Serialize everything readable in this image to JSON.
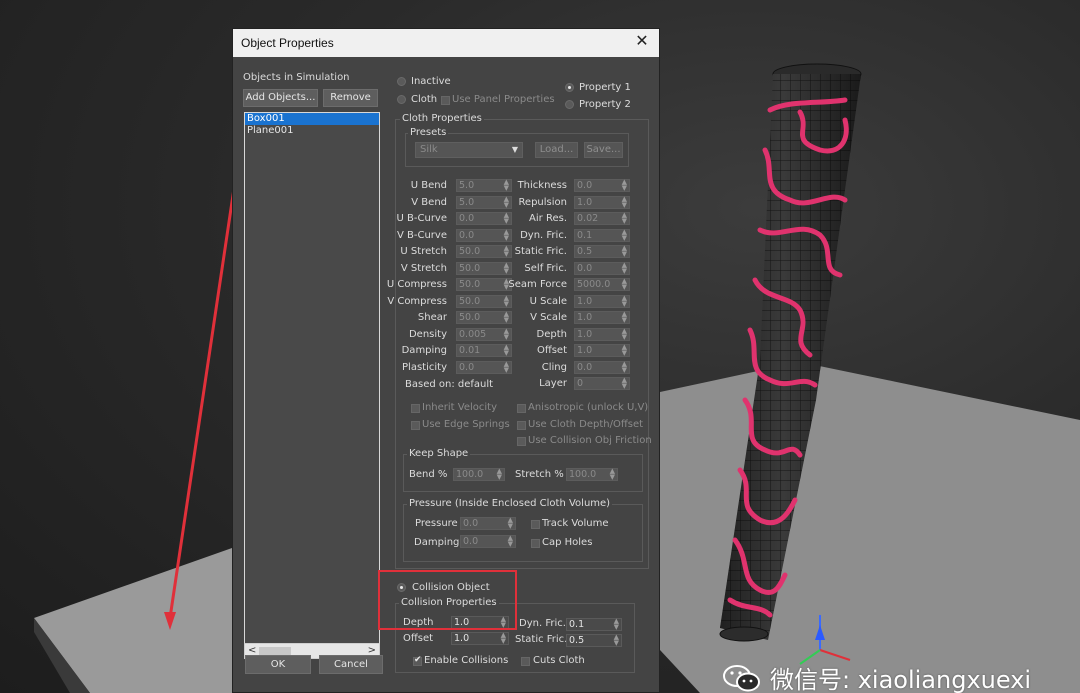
{
  "dialog": {
    "title": "Object Properties",
    "close_glyph": "✕",
    "objects_heading": "Objects in Simulation",
    "add_button": "Add Objects...",
    "remove_button": "Remove",
    "objects": [
      "Box001",
      "Plane001"
    ],
    "selected_object": "Box001",
    "ok_button": "OK",
    "cancel_button": "Cancel",
    "scroll_left": "<",
    "scroll_right": ">"
  },
  "mode": {
    "inactive_label": "Inactive",
    "cloth_label": "Cloth",
    "use_panel_label": "Use Panel Properties",
    "property1_label": "Property 1",
    "property2_label": "Property 2",
    "selected_property": "Property 1"
  },
  "cloth": {
    "heading": "Cloth Properties",
    "presets_heading": "Presets",
    "preset_value": "Silk",
    "load_button": "Load...",
    "save_button": "Save...",
    "left_params": [
      {
        "label": "U Bend",
        "value": "5.0"
      },
      {
        "label": "V Bend",
        "value": "5.0"
      },
      {
        "label": "U B-Curve",
        "value": "0.0"
      },
      {
        "label": "V B-Curve",
        "value": "0.0"
      },
      {
        "label": "U Stretch",
        "value": "50.0"
      },
      {
        "label": "V Stretch",
        "value": "50.0"
      },
      {
        "label": "U Compress",
        "value": "50.0"
      },
      {
        "label": "V Compress",
        "value": "50.0"
      },
      {
        "label": "Shear",
        "value": "50.0"
      },
      {
        "label": "Density",
        "value": "0.005"
      },
      {
        "label": "Damping",
        "value": "0.01"
      },
      {
        "label": "Plasticity",
        "value": "0.0"
      }
    ],
    "right_params": [
      {
        "label": "Thickness",
        "value": "0.0"
      },
      {
        "label": "Repulsion",
        "value": "1.0"
      },
      {
        "label": "Air Res.",
        "value": "0.02"
      },
      {
        "label": "Dyn. Fric.",
        "value": "0.1"
      },
      {
        "label": "Static Fric.",
        "value": "0.5"
      },
      {
        "label": "Self Fric.",
        "value": "0.0"
      },
      {
        "label": "Seam Force",
        "value": "5000.0"
      },
      {
        "label": "U Scale",
        "value": "1.0"
      },
      {
        "label": "V Scale",
        "value": "1.0"
      },
      {
        "label": "Depth",
        "value": "1.0"
      },
      {
        "label": "Offset",
        "value": "1.0"
      },
      {
        "label": "Cling",
        "value": "0.0"
      },
      {
        "label": "Layer",
        "value": "0"
      }
    ],
    "based_on": "Based on: default",
    "inherit_velocity": "Inherit Velocity",
    "anisotropic": "Anisotropic (unlock U,V)",
    "use_edge_springs": "Use Edge Springs",
    "use_cloth_depth": "Use Cloth Depth/Offset",
    "use_collision_friction": "Use Collision Obj Friction"
  },
  "keep_shape": {
    "heading": "Keep Shape",
    "bend_label": "Bend %",
    "bend_value": "100.0",
    "stretch_label": "Stretch %",
    "stretch_value": "100.0"
  },
  "pressure": {
    "heading": "Pressure (Inside Enclosed Cloth Volume)",
    "pressure_label": "Pressure",
    "pressure_value": "0.0",
    "damping_label": "Damping",
    "damping_value": "0.0",
    "track_volume": "Track Volume",
    "cap_holes": "Cap Holes"
  },
  "collision": {
    "object_label": "Collision Object",
    "heading": "Collision Properties",
    "depth_label": "Depth",
    "depth_value": "1.0",
    "offset_label": "Offset",
    "offset_value": "1.0",
    "dyn_fric_label": "Dyn. Fric.",
    "dyn_fric_value": "0.1",
    "static_fric_label": "Static Fric.",
    "static_fric_value": "0.5",
    "enable_collisions": "Enable Collisions",
    "cuts_cloth": "Cuts Cloth"
  },
  "watermark": {
    "text": "微信号: xiaoliangxuexi"
  },
  "colors": {
    "dialog_bg": "#444444",
    "selection_blue": "#1a73d0",
    "highlight_red": "#e0303a",
    "cloth_pink": "#e0336e"
  }
}
